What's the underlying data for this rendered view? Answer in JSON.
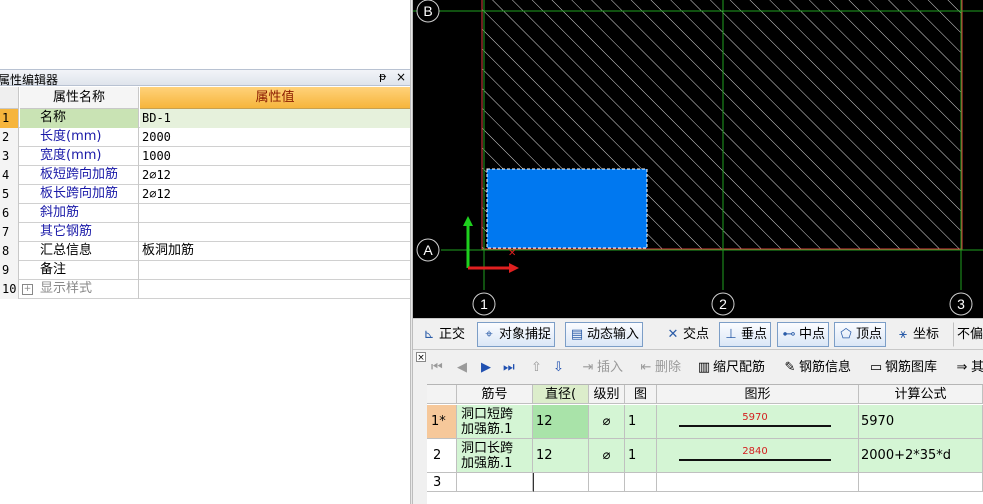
{
  "property_editor": {
    "title": "属性编辑器",
    "pin_icon": "ᵽ",
    "close_icon": "×",
    "header": {
      "name": "属性名称",
      "value": "属性值"
    },
    "rows": [
      {
        "num": "1",
        "name": "名称",
        "value": "BD-1"
      },
      {
        "num": "2",
        "name": "长度(mm)",
        "value": "2000"
      },
      {
        "num": "3",
        "name": "宽度(mm)",
        "value": "1000"
      },
      {
        "num": "4",
        "name": "板短跨向加筋",
        "value": "2⌀12"
      },
      {
        "num": "5",
        "name": "板长跨向加筋",
        "value": "2⌀12"
      },
      {
        "num": "6",
        "name": "斜加筋",
        "value": ""
      },
      {
        "num": "7",
        "name": "其它钢筋",
        "value": ""
      },
      {
        "num": "8",
        "name": "汇总信息",
        "value": "板洞加筋"
      },
      {
        "num": "9",
        "name": "备注",
        "value": ""
      },
      {
        "num": "10",
        "name": "显示样式",
        "value": "",
        "expander": "+"
      }
    ]
  },
  "canvas": {
    "axis_labels": {
      "row_b": "B",
      "row_a": "A",
      "col_1": "1",
      "col_2": "2",
      "col_3": "3"
    },
    "colors": {
      "background": "#000000",
      "grid": "#1fa01f",
      "slab_border": "#e04040",
      "hatch": "#d8d8d8",
      "opening_fill": "#0078f0",
      "axis_y": "#1ed01e",
      "axis_x": "#e02020"
    }
  },
  "snap_toolbar": {
    "items": [
      {
        "label": "正交",
        "icon": "ortho-icon",
        "glyph": "⊾",
        "on": false
      },
      {
        "label": "对象捕捉",
        "icon": "snap-icon",
        "glyph": "⌖",
        "on": true
      },
      {
        "label": "动态输入",
        "icon": "dynamic-input-icon",
        "glyph": "▤",
        "on": true
      },
      {
        "label": "交点",
        "icon": "intersection-icon",
        "glyph": "✕",
        "on": false
      },
      {
        "label": "垂点",
        "icon": "perpendicular-icon",
        "glyph": "⊥",
        "on": true
      },
      {
        "label": "中点",
        "icon": "midpoint-icon",
        "glyph": "⊷",
        "on": true
      },
      {
        "label": "顶点",
        "icon": "vertex-icon",
        "glyph": "⬠",
        "on": true
      },
      {
        "label": "坐标",
        "icon": "coordinate-icon",
        "glyph": "⚹",
        "on": false
      },
      {
        "label": "不偏",
        "icon": "",
        "glyph": "",
        "on": false
      }
    ]
  },
  "rebar_toolbar": {
    "close_icon": "×",
    "nav": [
      "⏮",
      "◀",
      "▶",
      "⏭"
    ],
    "move": [
      "⇧",
      "⇩"
    ],
    "items": [
      {
        "label": "插入",
        "glyph": "⇥",
        "disabled": true
      },
      {
        "label": "删除",
        "glyph": "⇤",
        "disabled": true
      },
      {
        "label": "缩尺配筋",
        "glyph": "▥",
        "disabled": false
      },
      {
        "label": "钢筋信息",
        "glyph": "✎",
        "disabled": false
      },
      {
        "label": "钢筋图库",
        "glyph": "▭",
        "disabled": false
      },
      {
        "label": "其",
        "glyph": "⇒",
        "disabled": false
      }
    ]
  },
  "rebar_table": {
    "headers": [
      "",
      "筋号",
      "直径(",
      "级别",
      "图",
      "图形",
      "计算公式"
    ],
    "rows": [
      {
        "num": "1*",
        "name_line1": "洞口短跨",
        "name_line2": "加强筋.1",
        "diameter": "12",
        "grade": "⌀",
        "figure": "1",
        "shape_value": "5970",
        "formula": "5970"
      },
      {
        "num": "2",
        "name_line1": "洞口长跨",
        "name_line2": "加强筋.1",
        "diameter": "12",
        "grade": "⌀",
        "figure": "1",
        "shape_value": "2840",
        "formula": "2000+2*35*d"
      },
      {
        "num": "3",
        "name_line1": "",
        "name_line2": "",
        "diameter": "",
        "grade": "",
        "figure": "",
        "shape_value": "",
        "formula": ""
      }
    ]
  }
}
